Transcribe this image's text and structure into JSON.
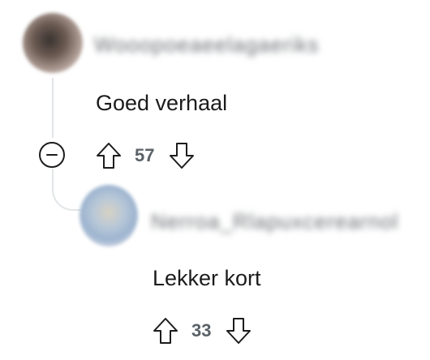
{
  "comments": [
    {
      "author": "Wooopoeaeelagaeriks",
      "text": "Goed verhaal",
      "votes": "57"
    },
    {
      "author": "Nerroa_Rlapuxcerearnol",
      "text": "Lekker kort",
      "votes": "33"
    }
  ],
  "icons": {
    "collapse": "minus-circle-icon",
    "upvote": "arrow-up-icon",
    "downvote": "arrow-down-icon"
  },
  "colors": {
    "text": "#1c1c1c",
    "vote_count": "#5a6268",
    "thread_line": "#e3e6e8"
  }
}
